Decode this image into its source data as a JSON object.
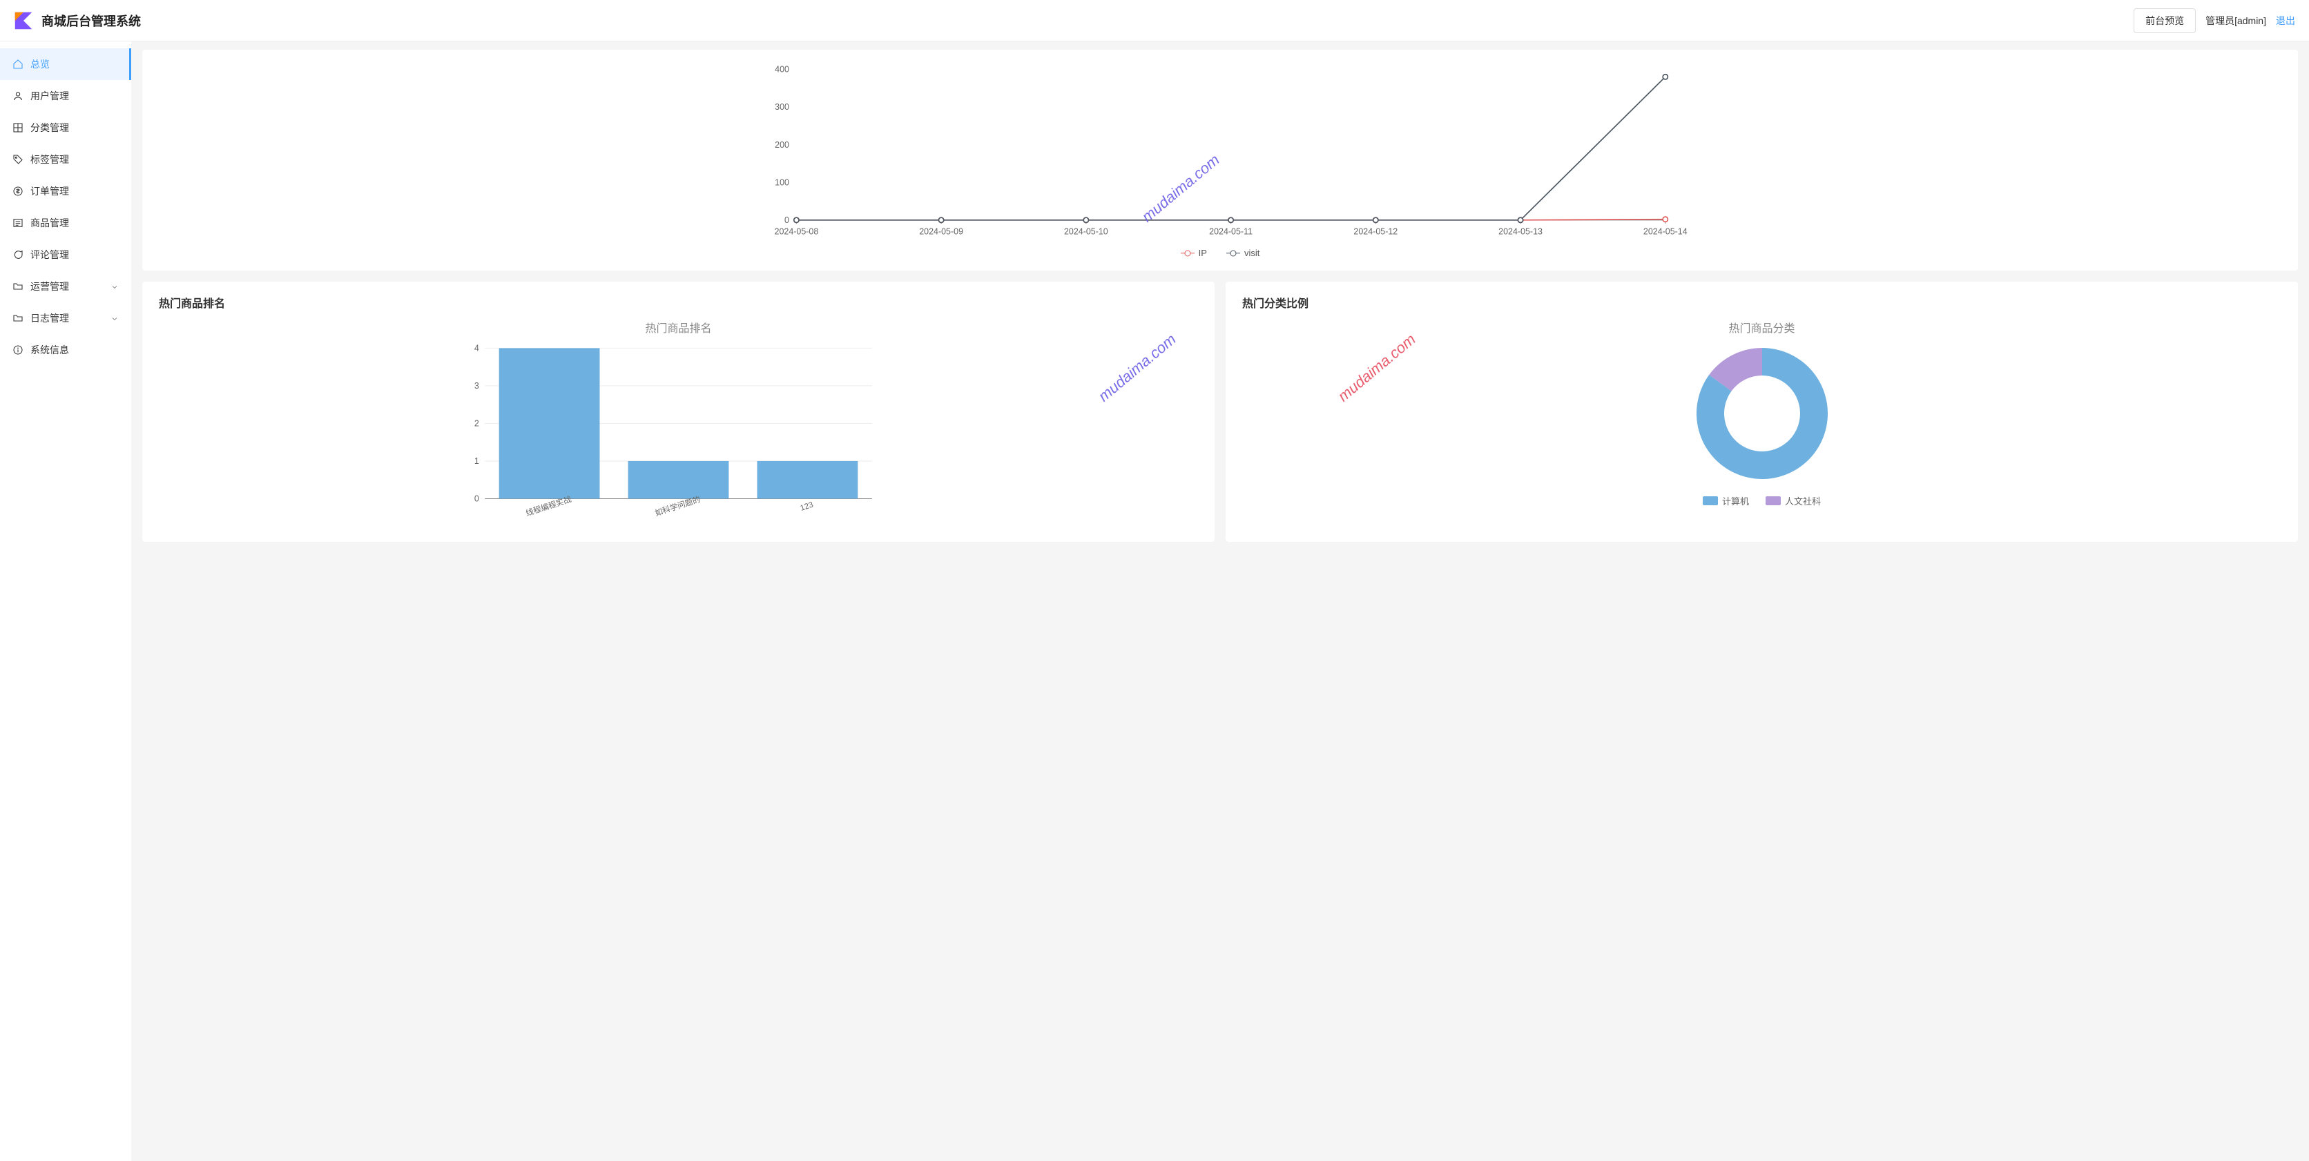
{
  "header": {
    "title": "商城后台管理系统",
    "preview_btn": "前台预览",
    "admin_text": "管理员[admin]",
    "logout": "退出"
  },
  "sidebar": {
    "items": [
      {
        "key": "overview",
        "label": "总览",
        "icon": "home",
        "active": true
      },
      {
        "key": "users",
        "label": "用户管理",
        "icon": "user"
      },
      {
        "key": "categories",
        "label": "分类管理",
        "icon": "grid"
      },
      {
        "key": "tags",
        "label": "标签管理",
        "icon": "tag"
      },
      {
        "key": "orders",
        "label": "订单管理",
        "icon": "dollar"
      },
      {
        "key": "products",
        "label": "商品管理",
        "icon": "list"
      },
      {
        "key": "comments",
        "label": "评论管理",
        "icon": "chat"
      },
      {
        "key": "operations",
        "label": "运营管理",
        "icon": "folder",
        "expandable": true
      },
      {
        "key": "logs",
        "label": "日志管理",
        "icon": "folder",
        "expandable": true
      },
      {
        "key": "system",
        "label": "系统信息",
        "icon": "info"
      }
    ]
  },
  "watermark": "mudaima.com",
  "panels": {
    "hot_products": {
      "title": "热门商品排名"
    },
    "hot_categories": {
      "title": "热门分类比例"
    }
  },
  "chart_data": [
    {
      "id": "visits_line",
      "type": "line",
      "title": "",
      "xlabel": "",
      "ylabel": "",
      "ylim": [
        0,
        400
      ],
      "yticks": [
        0,
        100,
        200,
        300,
        400
      ],
      "categories": [
        "2024-05-08",
        "2024-05-09",
        "2024-05-10",
        "2024-05-11",
        "2024-05-12",
        "2024-05-13",
        "2024-05-14"
      ],
      "series": [
        {
          "name": "IP",
          "color": "#e05b5b",
          "values": [
            0,
            0,
            0,
            0,
            0,
            0,
            2
          ]
        },
        {
          "name": "visit",
          "color": "#4a5560",
          "values": [
            0,
            0,
            0,
            0,
            0,
            0,
            380
          ]
        }
      ],
      "legend_position": "bottom"
    },
    {
      "id": "hot_products_bar",
      "type": "bar",
      "title": "热门商品排名",
      "xlabel": "",
      "ylabel": "",
      "ylim": [
        0,
        4
      ],
      "yticks": [
        0,
        1,
        2,
        3,
        4
      ],
      "categories": [
        "线程编程实战",
        "如科学问题的",
        "123"
      ],
      "values": [
        4,
        1,
        1
      ],
      "color": "#6eb0df"
    },
    {
      "id": "hot_categories_pie",
      "type": "pie",
      "title": "热门商品分类",
      "series": [
        {
          "name": "计算机",
          "value": 85,
          "color": "#6eb0df"
        },
        {
          "name": "人文社科",
          "value": 15,
          "color": "#b49ad8"
        }
      ],
      "donut": true
    }
  ]
}
